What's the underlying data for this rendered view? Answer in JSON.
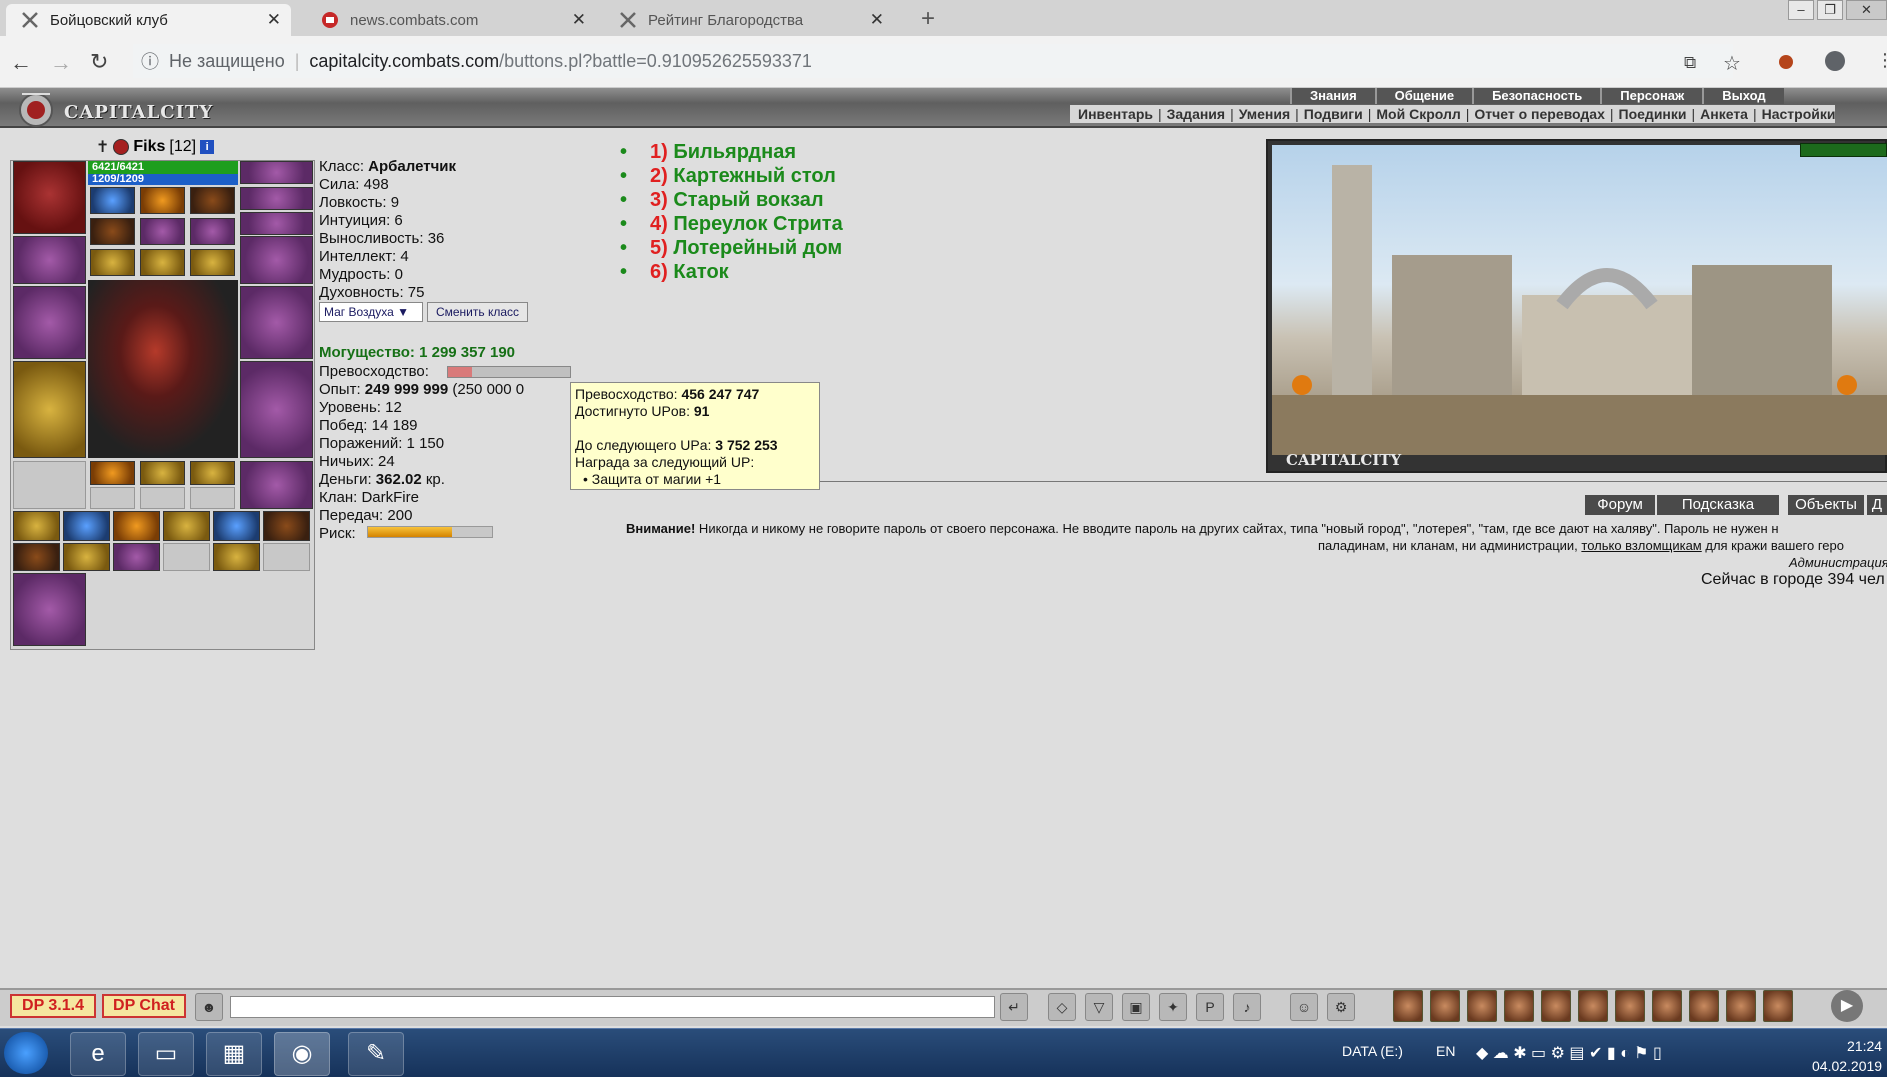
{
  "browser": {
    "tabs": [
      {
        "label": "Бойцовский клуб",
        "active": true
      },
      {
        "label": "news.combats.com",
        "active": false
      },
      {
        "label": "Рейтинг Благородства",
        "active": false
      }
    ],
    "security_label": "Не защищено",
    "url_host": "capitalcity.combats.com",
    "url_path": "/buttons.pl?battle=0.910952625593371"
  },
  "game": {
    "logo_text": "CAPITALCITY",
    "top_menu": [
      "Знания",
      "Общение",
      "Безопасность",
      "Персонаж",
      "Выход"
    ],
    "sub_menu": [
      "Инвентарь",
      "Задания",
      "Умения",
      "Подвиги",
      "Мой Скролл",
      "Отчет о переводах",
      "Поединки",
      "Анкета",
      "Настройки"
    ],
    "character": {
      "name": "Fiks",
      "level_tag": "[12]",
      "hp": "6421/6421",
      "mp": "1209/1209"
    },
    "stats": {
      "class_label": "Класс:",
      "class_value": "Арбалетчик",
      "strength": "Сила: 498",
      "agility": "Ловкость: 9",
      "intuition": "Интуиция: 6",
      "endurance": "Выносливость: 36",
      "intellect": "Интеллект: 4",
      "wisdom": "Мудрость: 0",
      "spirit": "Духовность: 75"
    },
    "class_select": "Маг Воздуха ▼",
    "class_change_button": "Сменить класс",
    "power": "Могущество: 1 299 357 190",
    "stats2": {
      "superiority_label": "Превосходство:",
      "superiority_fraction": 0.2,
      "exp_label": "Опыт:",
      "exp_value": "249 999 999",
      "exp_next": "(250 000 0",
      "level": "Уровень: 12",
      "wins": "Побед: 14 189",
      "losses": "Поражений: 1 150",
      "draws": "Ничьих: 24",
      "money_label": "Деньги:",
      "money_value": "362.02",
      "money_unit": "кр.",
      "clan": "Клан: DarkFire",
      "transfers": "Передач: 200",
      "risk_label": "Риск:",
      "risk_fraction": 0.68
    },
    "tooltip": {
      "superiority_label": "Превосходство:",
      "superiority_value": "456 247 747",
      "ups_label": "Достигнуто UPов:",
      "ups_value": "91",
      "next_label": "До следующего UPа:",
      "next_value": "3 752 253",
      "reward_label": "Награда за следующий UP:",
      "reward_item": "• Защита от магии +1"
    },
    "locations": [
      {
        "num": "1)",
        "name": "Бильярдная"
      },
      {
        "num": "2)",
        "name": "Картежный стол"
      },
      {
        "num": "3)",
        "name": "Старый вокзал"
      },
      {
        "num": "4)",
        "name": "Переулок Стрита"
      },
      {
        "num": "5)",
        "name": "Лотерейный дом"
      },
      {
        "num": "6)",
        "name": "Каток"
      }
    ],
    "city_image_caption": "CAPITALCITY",
    "bottom_buttons": [
      "Форум",
      "Подсказка",
      "Объекты",
      "Д"
    ],
    "warning": {
      "bold": "Внимание!",
      "text1": " Никогда и никому не говорите пароль от своего персонажа. Не вводите пароль на других сайтах, типа \"новый город\", \"лотерея\", \"там, где все дают на халяву\". Пароль не нужен н",
      "text2": "паладинам, ни кланам, ни администрации, ",
      "link": "только взломщикам",
      "text3": " для кражи вашего геро"
    },
    "admin": "Администрация",
    "online": "Сейчас в городе 394 чел"
  },
  "chat": {
    "dp_version": "DP 3.1.4",
    "dp_chat": "DP Chat"
  },
  "taskbar": {
    "drive": "DATA (E:)",
    "lang": "EN",
    "time": "21:24",
    "date": "04.02.2019"
  },
  "colors": {
    "location_green": "#1b8a1b",
    "location_red": "#e02020",
    "power_green": "#167016",
    "tooltip_bg": "#ffffcc"
  }
}
